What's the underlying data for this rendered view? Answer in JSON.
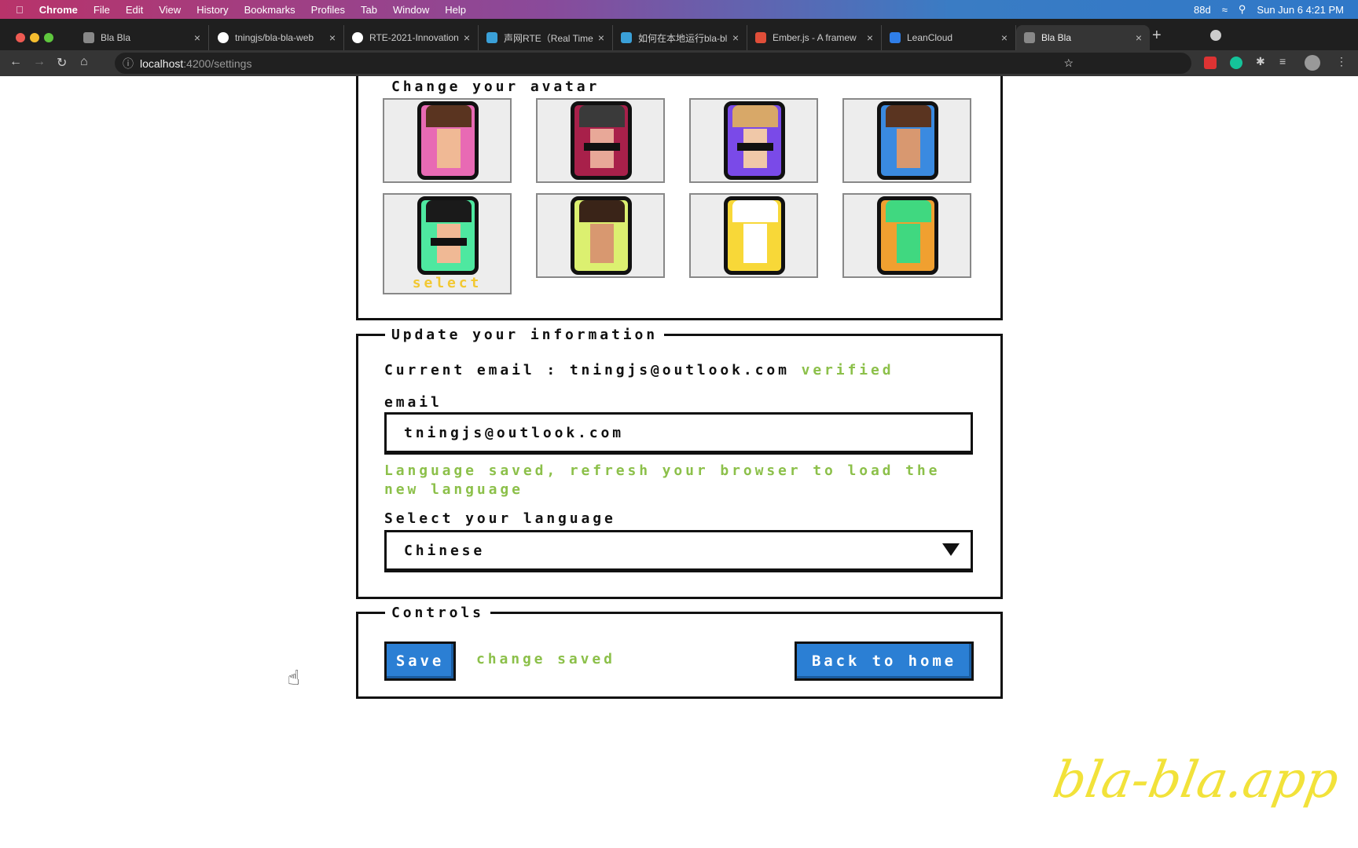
{
  "menubar": {
    "app": "Chrome",
    "items": [
      "File",
      "Edit",
      "View",
      "History",
      "Bookmarks",
      "Profiles",
      "Tab",
      "Window",
      "Help"
    ],
    "linkedin": "88d",
    "datetime": "Sun Jun 6  4:21 PM"
  },
  "tabs": [
    {
      "title": "Bla Bla",
      "icon": "#888"
    },
    {
      "title": "tningjs/bla-bla-web",
      "icon": "#fff"
    },
    {
      "title": "RTE-2021-Innovation",
      "icon": "#fff"
    },
    {
      "title": "声网RTE（Real Time",
      "icon": "#3aa0d8"
    },
    {
      "title": "如何在本地运行bla-bl",
      "icon": "#3aa0d8"
    },
    {
      "title": "Ember.js - A framew",
      "icon": "#e04e39"
    },
    {
      "title": "LeanCloud",
      "icon": "#2f7ee8"
    },
    {
      "title": "Bla Bla",
      "icon": "#888"
    }
  ],
  "address": {
    "host": "localhost",
    "path": ":4200/settings"
  },
  "avatar_section": {
    "title": "Change your avatar",
    "select_label": "select",
    "avatars": [
      {
        "bg": "#e86ab4",
        "hair": "#5a3420",
        "skin": "#f0b995",
        "glasses": false
      },
      {
        "bg": "#a8204a",
        "hair": "#3a3a3a",
        "skin": "#e8a898",
        "glasses": true
      },
      {
        "bg": "#7a4ae8",
        "hair": "#d8a868",
        "skin": "#f0c8a8",
        "glasses": true
      },
      {
        "bg": "#3a8ae0",
        "hair": "#5a3420",
        "skin": "#d89870",
        "glasses": false
      },
      {
        "bg": "#4ee8a0",
        "hair": "#1a1a1a",
        "skin": "#f0b995",
        "glasses": true
      },
      {
        "bg": "#dcf070",
        "hair": "#3a2418",
        "skin": "#d89870",
        "glasses": false
      },
      {
        "bg": "#f8d838",
        "hair": "#ffffff",
        "skin": "#ffffff",
        "glasses": false
      },
      {
        "bg": "#f0a030",
        "hair": "#40d880",
        "skin": "#40d880",
        "glasses": false
      }
    ]
  },
  "info_section": {
    "title": "Update your information",
    "current_email_label": "Current email :",
    "current_email": "tningjs@outlook.com",
    "verified": "verified",
    "email_label": "email",
    "email_value": "tningjs@outlook.com",
    "language_notice": "Language saved, refresh your browser to load the new language",
    "language_label": "Select your language",
    "language_value": "Chinese"
  },
  "controls": {
    "title": "Controls",
    "save": "Save",
    "status": "change saved",
    "back": "Back to home"
  },
  "watermark": "bla-bla.app"
}
